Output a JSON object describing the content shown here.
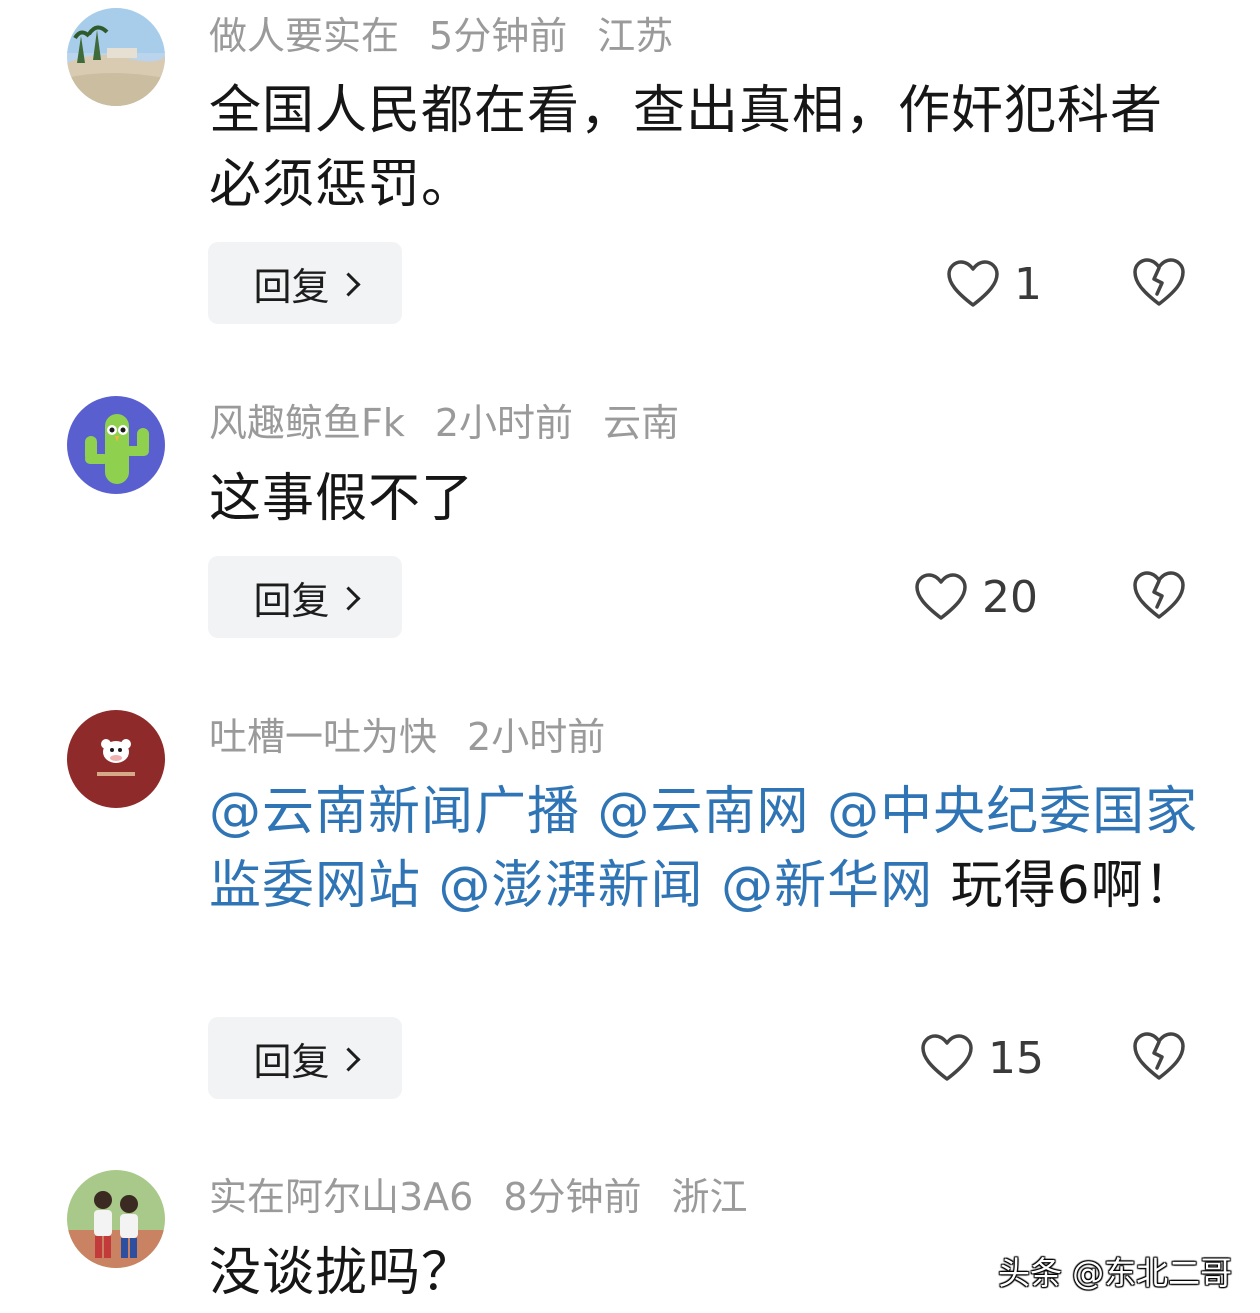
{
  "comments": [
    {
      "username": "做人要实在",
      "time": "5分钟前",
      "location": "江苏",
      "text": "全国人民都在看，查出真相，作奸犯科者必须惩罚。",
      "reply_label": "回复",
      "likes": "1",
      "avatar_icon": "beach-photo-avatar"
    },
    {
      "username": "风趣鲸鱼Fk",
      "time": "2小时前",
      "location": "云南",
      "text": "这事假不了",
      "reply_label": "回复",
      "likes": "20",
      "avatar_icon": "cactus-avatar"
    },
    {
      "username": "吐槽一吐为快",
      "time": "2小时前",
      "mentions": [
        "@云南新闻广播",
        "@云南网",
        "@中央纪委国家监委网站",
        "@澎湃新闻",
        "@新华网"
      ],
      "text_tail": "玩得6啊！",
      "reply_label": "回复",
      "likes": "15",
      "avatar_icon": "cow-avatar"
    },
    {
      "username": "实在阿尔山3A6",
      "time": "8分钟前",
      "location": "浙江",
      "text": "没谈拢吗？",
      "avatar_icon": "children-photo-avatar"
    }
  ],
  "watermark": "头条 @东北二哥",
  "colors": {
    "mention": "#2f74b4",
    "meta": "#9a9a9a",
    "reply_bg": "#f2f3f5"
  }
}
